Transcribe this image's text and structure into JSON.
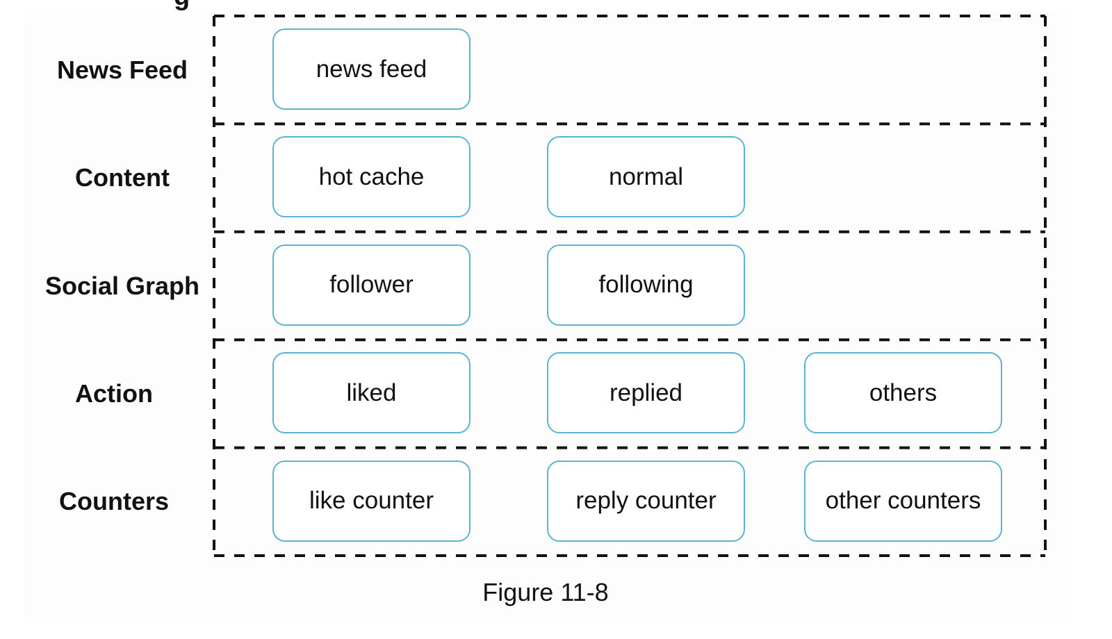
{
  "diagram": {
    "type": "layered-cache-tiers",
    "caption": "Figure 11-8",
    "clipped_top_text": "g",
    "colors": {
      "node_border": "#5bb4cf",
      "frame_dash": "#111111",
      "text": "#111111"
    },
    "tiers": [
      {
        "label": "News Feed",
        "nodes": [
          "news feed"
        ]
      },
      {
        "label": "Content",
        "nodes": [
          "hot cache",
          "normal"
        ]
      },
      {
        "label": "Social Graph",
        "nodes": [
          "follower",
          "following"
        ]
      },
      {
        "label": "Action",
        "nodes": [
          "liked",
          "replied",
          "others"
        ]
      },
      {
        "label": "Counters",
        "nodes": [
          "like counter",
          "reply counter",
          "other counters"
        ]
      }
    ]
  }
}
